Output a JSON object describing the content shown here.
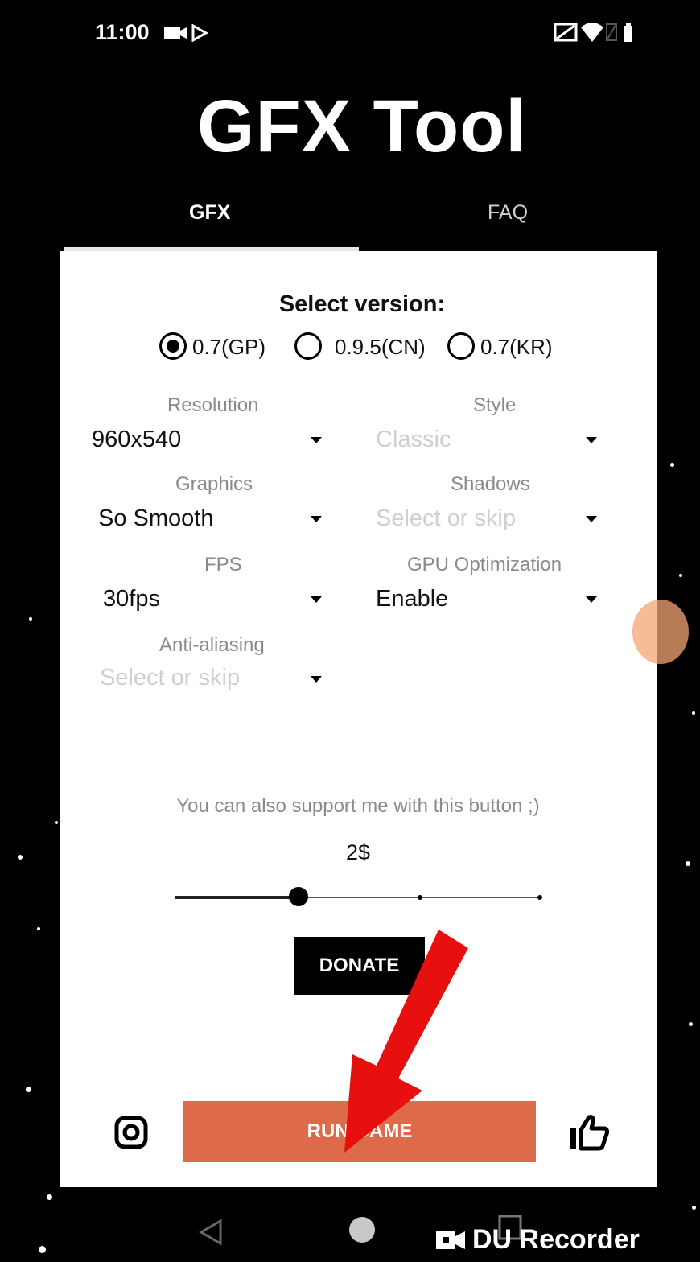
{
  "status_bar": {
    "time": "11:00",
    "left_icons": [
      "video-icon",
      "play-store-icon"
    ],
    "right_icons": [
      "cast-icon",
      "wifi-icon",
      "no-sim-icon",
      "battery-icon"
    ]
  },
  "app": {
    "title": "GFX Tool"
  },
  "tabs": [
    {
      "label": "GFX",
      "active": true
    },
    {
      "label": "FAQ",
      "active": false
    }
  ],
  "version": {
    "title": "Select version:",
    "options": [
      {
        "label": "0.7(GP)",
        "selected": true
      },
      {
        "label": "0.9.5(CN)",
        "selected": false
      },
      {
        "label": "0.7(KR)",
        "selected": false
      }
    ]
  },
  "settings": {
    "resolution": {
      "label": "Resolution",
      "value": "960x540"
    },
    "style": {
      "label": "Style",
      "value": "Classic",
      "placeholder": true
    },
    "graphics": {
      "label": "Graphics",
      "value": "So Smooth"
    },
    "shadows": {
      "label": "Shadows",
      "value": "Select or skip",
      "placeholder": true
    },
    "fps": {
      "label": "FPS",
      "value": "30fps"
    },
    "gpu": {
      "label": "GPU Optimization",
      "value": "Enable"
    },
    "antialiasing": {
      "label": "Anti-aliasing",
      "value": "Select or skip",
      "placeholder": true
    }
  },
  "support": {
    "text": "You can also support me with this button ;)",
    "amount": "2$",
    "slider_value_fraction": 0.33,
    "donate_label": "DONATE"
  },
  "run_game_label": "RUN GAME",
  "accent_color": "#dd6a48",
  "footer_icons": [
    "instagram-icon",
    "thumbs-up-icon"
  ],
  "nav": {
    "buttons": [
      "back-icon",
      "home-icon",
      "recents-icon"
    ],
    "recorder_label": "DU Recorder",
    "recorder_icon": "camera-icon"
  }
}
